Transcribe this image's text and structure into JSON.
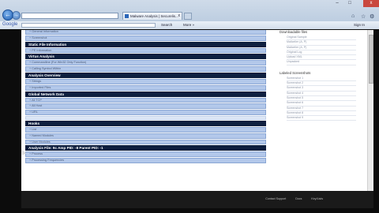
{
  "browser": {
    "tab_title": "Malware Analysis | Securelis...",
    "tab_close": "x",
    "search_engine": "Google",
    "toolbar_items": [
      "Search",
      "More »"
    ],
    "toolbar_right": "Sign In",
    "win_controls": [
      "–",
      "□",
      "x"
    ]
  },
  "sections": [
    {
      "type": "item",
      "label": "General Information"
    },
    {
      "type": "item",
      "label": "Screenshot"
    },
    {
      "type": "header",
      "label": "Static File Information"
    },
    {
      "type": "item",
      "label": "PE Information"
    },
    {
      "type": "header",
      "label": "Virtus Analysis"
    },
    {
      "type": "item",
      "label": "Commandline (For Win32 Only Function)"
    },
    {
      "type": "item",
      "label": "Calling Symbol Within"
    },
    {
      "type": "header",
      "label": "Analysis Overview"
    },
    {
      "type": "item",
      "label": "Strings"
    },
    {
      "type": "item",
      "label": "Imported Files"
    },
    {
      "type": "header",
      "label": "Global Network Data"
    },
    {
      "type": "item",
      "label": "All TCP"
    },
    {
      "type": "item",
      "label": "All Host"
    },
    {
      "type": "item",
      "label": "URL"
    },
    {
      "type": "blank",
      "label": ""
    },
    {
      "type": "header",
      "label": "Hooks"
    },
    {
      "type": "item",
      "label": "List"
    },
    {
      "type": "item",
      "label": "Named Modules"
    },
    {
      "type": "item",
      "label": "User Modules"
    },
    {
      "type": "header",
      "label": "Analysis File: 9c Amp PID: -8 Parent PID: -1"
    },
    {
      "type": "item",
      "label": "Process"
    },
    {
      "type": "item",
      "label": "Processing Frequencies"
    }
  ],
  "sidebar": {
    "download_title": "Downloadable files",
    "downloads": [
      "Original Sample",
      "Malicelier (A, P)",
      "Malicelier (A, P)",
      "Original Log",
      "Upload XML",
      "Unpacked"
    ],
    "screenshots_title": "Labeled Screenshots",
    "screenshots": [
      "Screenshot 1",
      "Screenshot 2",
      "Screenshot 3",
      "Screenshot 4",
      "Screenshot 5",
      "Screenshot 6",
      "Screenshot 7",
      "Screenshot 8",
      "Screenshot 9"
    ]
  },
  "footer": {
    "links": [
      "Contact Support",
      "Docs",
      "Key/Lists"
    ]
  }
}
